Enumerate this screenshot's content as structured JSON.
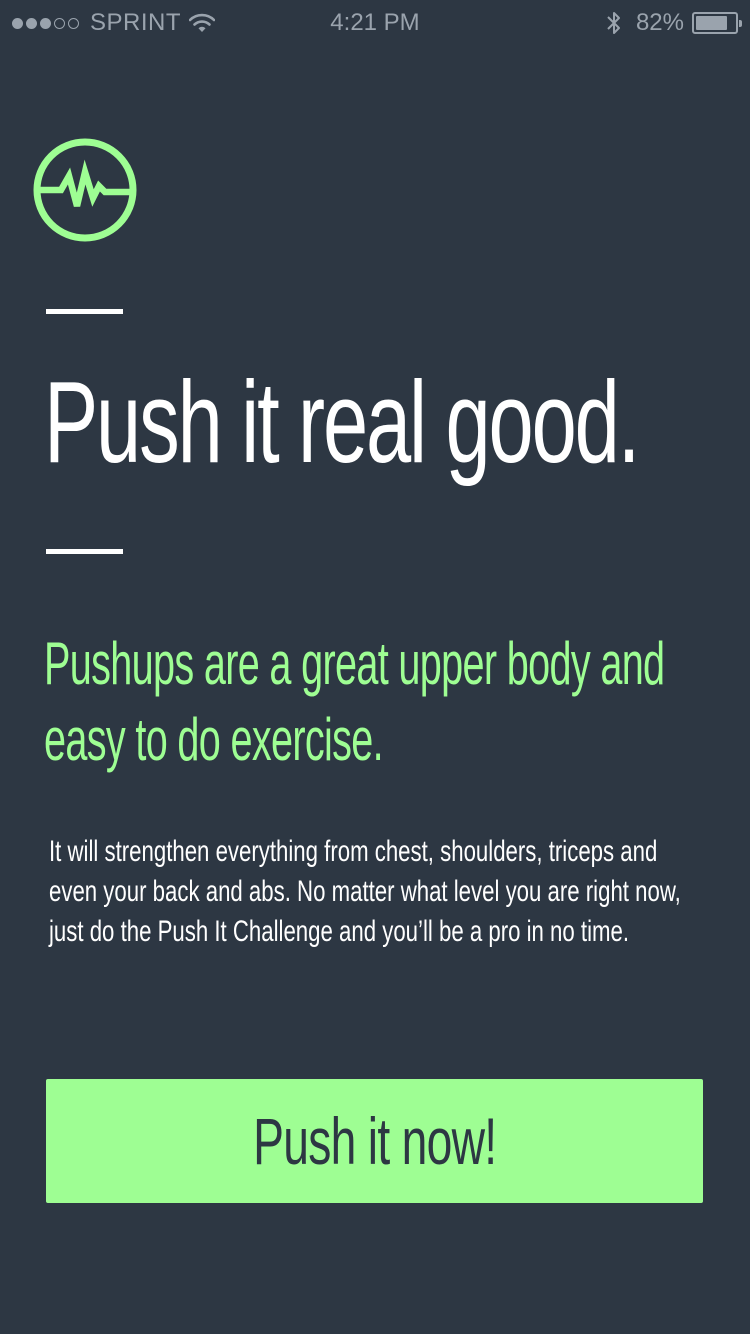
{
  "status_bar": {
    "carrier": "SPRINT",
    "time": "4:21 PM",
    "battery_percent_text": "82%",
    "battery_level": 0.82,
    "signal_bars_filled": 3,
    "signal_bars_total": 5,
    "icons": [
      "wifi-icon",
      "bluetooth-icon",
      "battery-icon"
    ]
  },
  "logo": {
    "icon": "heartbeat-pulse-icon"
  },
  "headline": "Push it real good.",
  "subhead": "Pushups are a great upper body and easy to do exercise.",
  "body": "It will strengthen everything from chest, shoulders, triceps and even your back and abs. No matter what level you are right now, just do the Push It Challenge and you’ll be a pro in no time.",
  "cta": {
    "label": "Push it now!"
  },
  "colors": {
    "background": "#2d3743",
    "accent": "#9efe93",
    "text": "#ffffff",
    "status": "#9aa3ad"
  }
}
